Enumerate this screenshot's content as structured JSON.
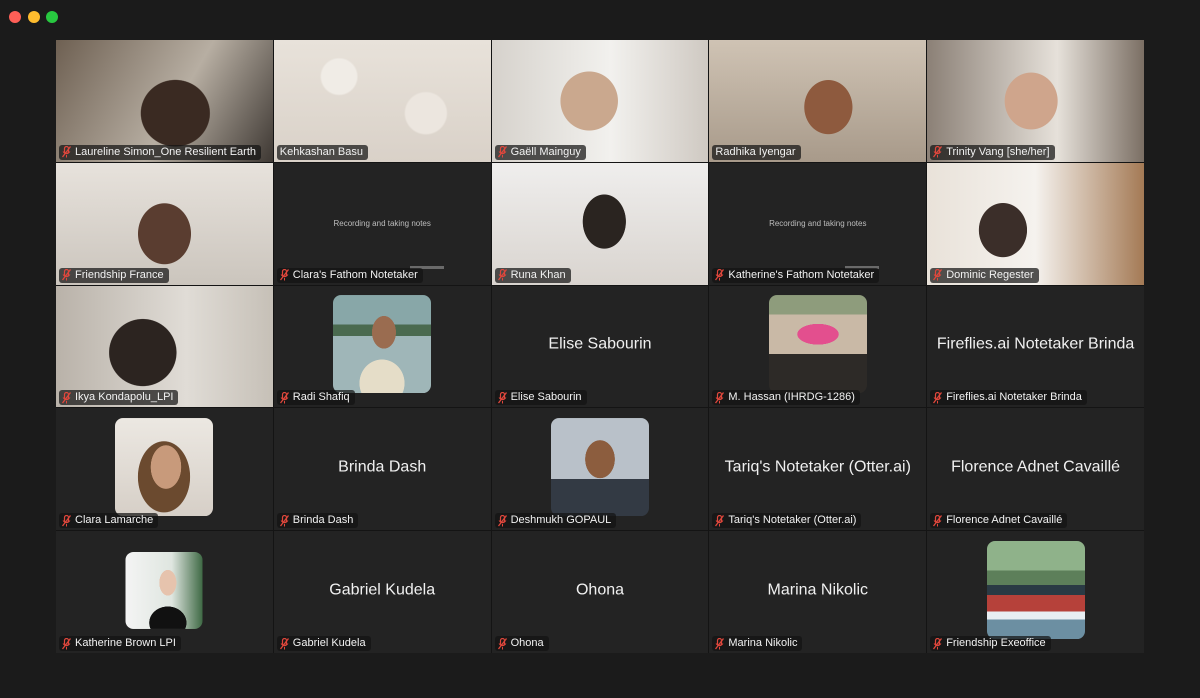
{
  "window": {
    "controls": [
      "close",
      "minimize",
      "maximize"
    ]
  },
  "recording_notice": "Recording and taking notes",
  "accent_colors": {
    "active_speaker_border": "#3dbb3d",
    "muted_mic": "#e0473c"
  },
  "participants": [
    {
      "name": "Laureline Simon_One Resilient Earth",
      "mode": "video",
      "muted": true
    },
    {
      "name": "Kehkashan Basu",
      "mode": "video",
      "muted": false,
      "speaking": true
    },
    {
      "name": "Gaëll Mainguy",
      "mode": "video",
      "muted": true
    },
    {
      "name": "Radhika Iyengar",
      "mode": "video",
      "muted": false
    },
    {
      "name": "Trinity Vang [she/her]",
      "mode": "video",
      "muted": true
    },
    {
      "name": "Friendship France",
      "mode": "video",
      "muted": true
    },
    {
      "name": "Clara's Fathom Notetaker",
      "mode": "recording",
      "muted": true
    },
    {
      "name": "Runa Khan",
      "mode": "video",
      "muted": true
    },
    {
      "name": "Katherine's Fathom Notetaker",
      "mode": "recording",
      "muted": true
    },
    {
      "name": "Dominic Regester",
      "mode": "video",
      "muted": true
    },
    {
      "name": "Ikya Kondapolu_LPI",
      "mode": "video",
      "muted": true
    },
    {
      "name": "Radi Shafiq",
      "mode": "avatar",
      "muted": true
    },
    {
      "name": "Elise Sabourin",
      "mode": "name",
      "muted": true
    },
    {
      "name": "M. Hassan (IHRDG-1286)",
      "mode": "avatar",
      "muted": true
    },
    {
      "name": "Fireflies.ai Notetaker Brinda",
      "mode": "name",
      "muted": true
    },
    {
      "name": "Clara Lamarche",
      "mode": "avatar",
      "muted": true
    },
    {
      "name": "Brinda Dash",
      "mode": "name",
      "muted": true
    },
    {
      "name": "Deshmukh GOPAUL",
      "mode": "avatar",
      "muted": true
    },
    {
      "name": "Tariq's Notetaker (Otter.ai)",
      "mode": "name",
      "muted": true
    },
    {
      "name": "Florence Adnet Cavaillé",
      "mode": "name",
      "muted": true
    },
    {
      "name": "Katherine Brown LPI",
      "mode": "avatar",
      "muted": true
    },
    {
      "name": "Gabriel Kudela",
      "mode": "name",
      "muted": true
    },
    {
      "name": "Ohona",
      "mode": "name",
      "muted": true
    },
    {
      "name": "Marina Nikolic",
      "mode": "name",
      "muted": true
    },
    {
      "name": "Friendship Exeoffice",
      "mode": "avatar",
      "muted": true
    }
  ]
}
